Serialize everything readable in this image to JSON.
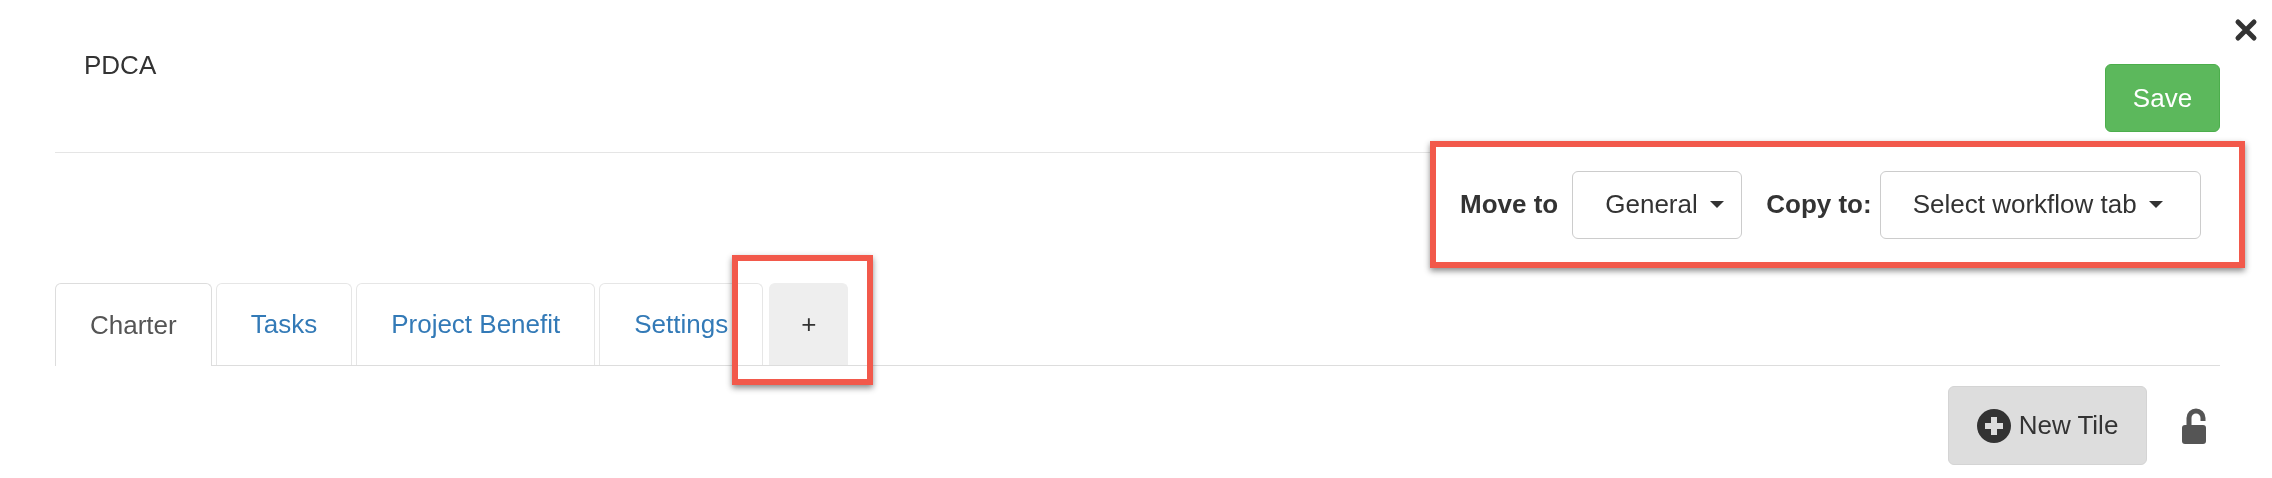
{
  "title": "PDCA",
  "save_button": "Save",
  "toolbar": {
    "highlighted": true,
    "move_label": "Move to",
    "move_value": "General",
    "copy_label": "Copy to:",
    "copy_value": "Select workflow tab"
  },
  "tabs": [
    {
      "kind": "page",
      "label": "Charter",
      "selected": true,
      "highlighted": false
    },
    {
      "kind": "page",
      "label": "Tasks",
      "selected": false,
      "highlighted": false
    },
    {
      "kind": "page",
      "label": "Project Benefit",
      "selected": false,
      "highlighted": false
    },
    {
      "kind": "page",
      "label": "Settings",
      "selected": false,
      "highlighted": false
    },
    {
      "kind": "add",
      "label": "+",
      "selected": false,
      "highlighted": true
    }
  ],
  "new_tile_button": "New Tile"
}
